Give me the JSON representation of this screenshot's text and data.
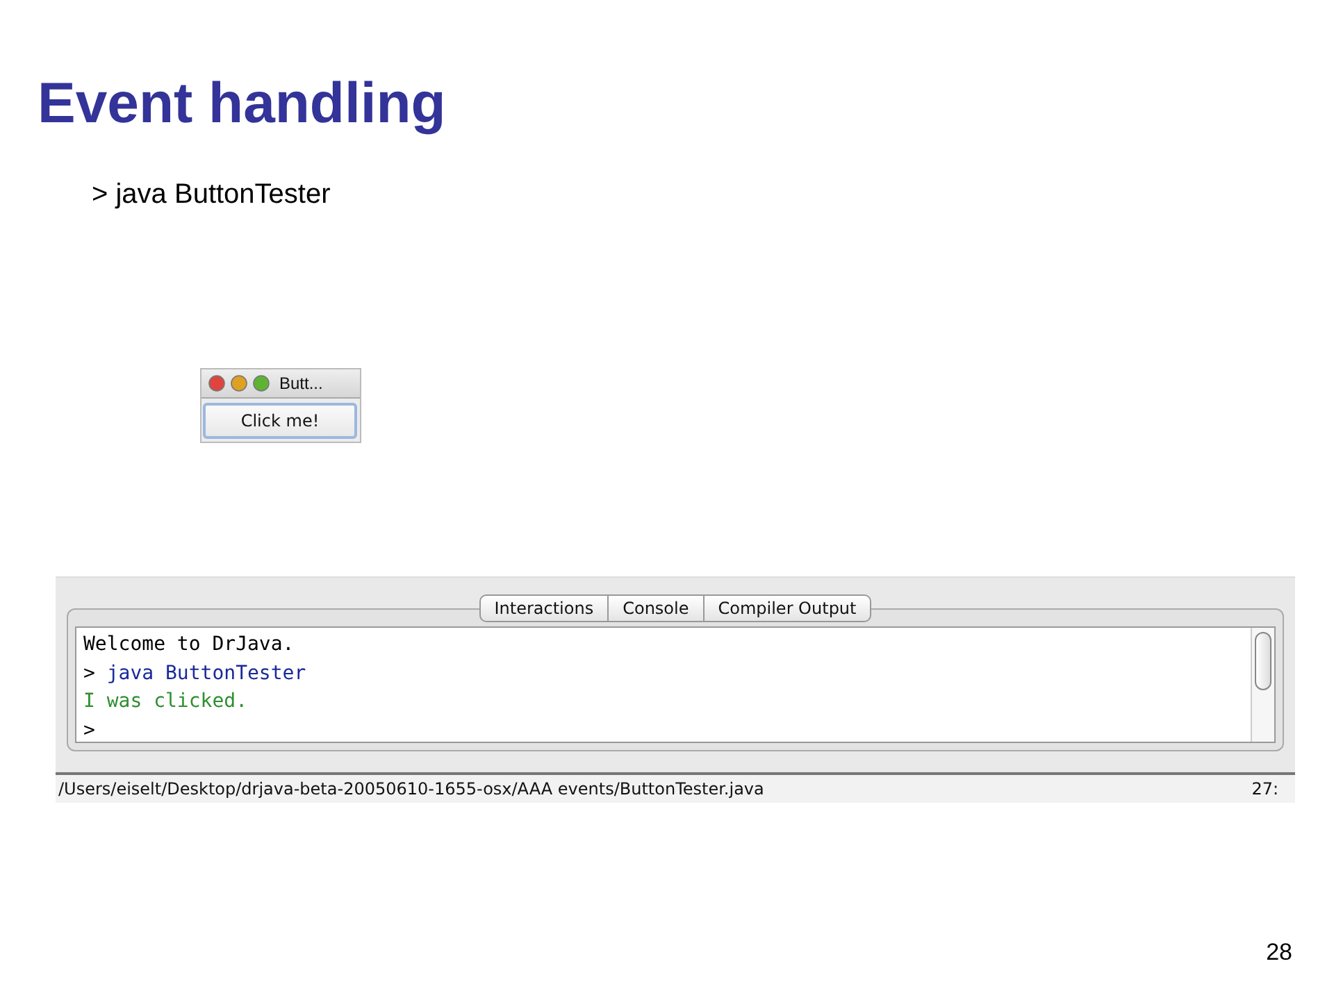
{
  "slide": {
    "title": "Event handling",
    "command": "> java ButtonTester",
    "page_number": "28"
  },
  "mini_window": {
    "title": "Butt...",
    "button": "Click me!"
  },
  "drjava": {
    "tabs": [
      {
        "label": "Interactions"
      },
      {
        "label": "Console"
      },
      {
        "label": "Compiler Output"
      }
    ],
    "console_lines": [
      {
        "kind": "plain",
        "text": "Welcome to DrJava."
      },
      {
        "kind": "input",
        "prompt": ">",
        "text": "java ButtonTester"
      },
      {
        "kind": "output",
        "text": "I was clicked."
      },
      {
        "kind": "plain",
        "text": ">"
      }
    ],
    "status_path": "/Users/eiselt/Desktop/drjava-beta-20050610-1655-osx/AAA events/ButtonTester.java",
    "status_position": "27:"
  }
}
